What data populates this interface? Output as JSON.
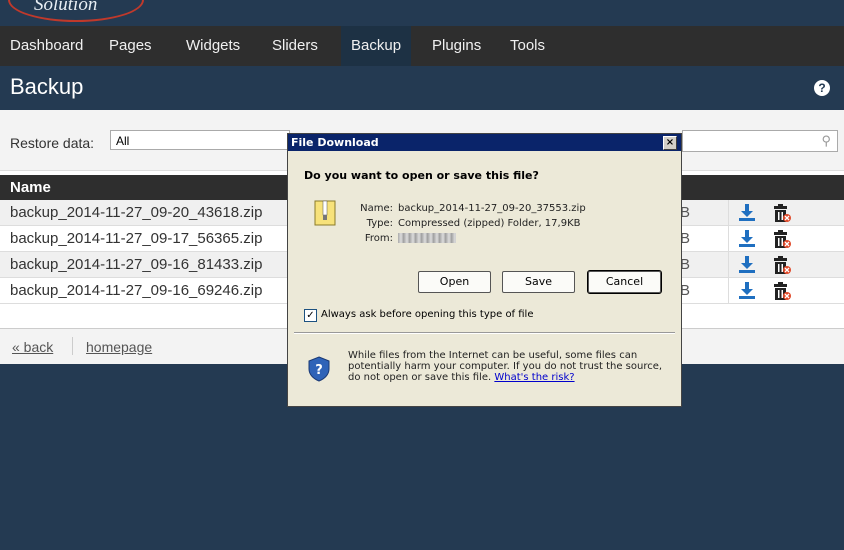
{
  "logo": {
    "text": "Solution"
  },
  "nav": {
    "items": [
      "Dashboard",
      "Pages",
      "Widgets",
      "Sliders",
      "Backup",
      "Plugins",
      "Tools"
    ],
    "active": "Backup"
  },
  "page": {
    "title": "Backup",
    "help": "?"
  },
  "filters": {
    "restore_label": "Restore data:",
    "restore_value": "All"
  },
  "table": {
    "header": "Name",
    "rows": [
      {
        "name": "backup_2014-11-27_09-20_43618.zip",
        "size": "B"
      },
      {
        "name": "backup_2014-11-27_09-17_56365.zip",
        "size": "B"
      },
      {
        "name": "backup_2014-11-27_09-16_81433.zip",
        "size": "B"
      },
      {
        "name": "backup_2014-11-27_09-16_69246.zip",
        "size": "B"
      }
    ]
  },
  "footer": {
    "back": "« back",
    "homepage": "homepage"
  },
  "dialog": {
    "title": "File Download",
    "close": "×",
    "question": "Do you want to open or save this file?",
    "name_label": "Name:",
    "name_value": "backup_2014-11-27_09-20_37553.zip",
    "type_label": "Type:",
    "type_value": "Compressed (zipped) Folder, 17,9KB",
    "from_label": "From:",
    "open": "Open",
    "save": "Save",
    "cancel": "Cancel",
    "checkbox_label": "Always ask before opening this type of file",
    "checkbox_checked": true,
    "warning": "While files from the Internet can be useful, some files can potentially harm your computer. If you do not trust the source, do not open or save this file.",
    "risk_link": "What's the risk?"
  },
  "colors": {
    "header_bg": "#243a52",
    "navbar_bg": "#2e2e2e",
    "download_blue": "#1f6fc0",
    "dialog_bg": "#ece9d8"
  }
}
